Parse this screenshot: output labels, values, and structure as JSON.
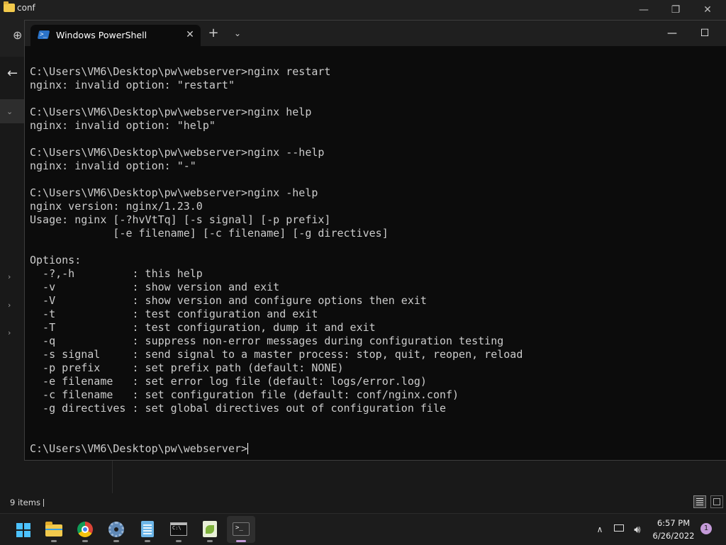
{
  "explorer": {
    "window_title": "conf",
    "status_text": "9 items",
    "controls": {
      "minimize": "—",
      "restore": "❐",
      "close": "✕"
    },
    "new_tab_glyph": "⊕",
    "back_glyph": "←"
  },
  "terminal": {
    "tab_title": "Windows PowerShell",
    "tab_close": "✕",
    "new_tab": "+",
    "dropdown": "⌄",
    "controls": {
      "minimize": "—",
      "maximize": "☐"
    },
    "lines": [
      "C:\\Users\\VM6\\Desktop\\pw\\webserver>nginx restart",
      "nginx: invalid option: \"restart\"",
      "",
      "C:\\Users\\VM6\\Desktop\\pw\\webserver>nginx help",
      "nginx: invalid option: \"help\"",
      "",
      "C:\\Users\\VM6\\Desktop\\pw\\webserver>nginx --help",
      "nginx: invalid option: \"-\"",
      "",
      "C:\\Users\\VM6\\Desktop\\pw\\webserver>nginx -help",
      "nginx version: nginx/1.23.0",
      "Usage: nginx [-?hvVtTq] [-s signal] [-p prefix]",
      "             [-e filename] [-c filename] [-g directives]",
      "",
      "Options:",
      "  -?,-h         : this help",
      "  -v            : show version and exit",
      "  -V            : show version and configure options then exit",
      "  -t            : test configuration and exit",
      "  -T            : test configuration, dump it and exit",
      "  -q            : suppress non-error messages during configuration testing",
      "  -s signal     : send signal to a master process: stop, quit, reopen, reload",
      "  -p prefix     : set prefix path (default: NONE)",
      "  -e filename   : set error log file (default: logs/error.log)",
      "  -c filename   : set configuration file (default: conf/nginx.conf)",
      "  -g directives : set global directives out of configuration file",
      "",
      ""
    ],
    "prompt": "C:\\Users\\VM6\\Desktop\\pw\\webserver>"
  },
  "taskbar": {
    "apps": [
      {
        "name": "start",
        "icon": "windows-logo-icon"
      },
      {
        "name": "file-explorer",
        "icon": "folder-icon"
      },
      {
        "name": "chrome",
        "icon": "chrome-icon"
      },
      {
        "name": "settings",
        "icon": "gear-icon"
      },
      {
        "name": "notepad",
        "icon": "notepad-icon"
      },
      {
        "name": "command-prompt",
        "icon": "cmd-icon"
      },
      {
        "name": "notepad-plus-plus",
        "icon": "notepad-plus-plus-icon"
      },
      {
        "name": "windows-terminal",
        "icon": "terminal-icon"
      }
    ],
    "tray_chevron": "∧",
    "volume_glyph": "🔊︎",
    "time": "6:57 PM",
    "date": "6/26/2022",
    "notification_count": "1"
  },
  "colors": {
    "terminal_bg": "#0c0c0c",
    "terminal_text": "#cccccc",
    "accent": "#c49ad8"
  }
}
